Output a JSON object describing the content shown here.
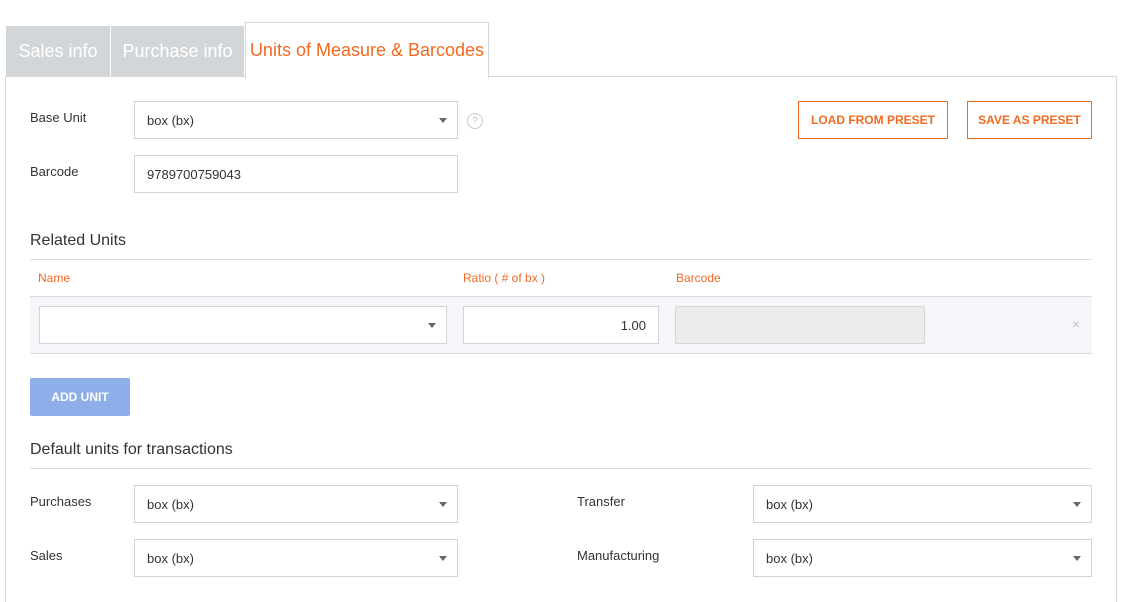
{
  "tabs": [
    {
      "label": "Sales info"
    },
    {
      "label": "Purchase info"
    },
    {
      "label": "Units of Measure & Barcodes"
    }
  ],
  "base_unit": {
    "label": "Base Unit",
    "value": "box (bx)",
    "help": "?"
  },
  "barcode": {
    "label": "Barcode",
    "value": "9789700759043"
  },
  "buttons": {
    "load_preset": "LOAD FROM PRESET",
    "save_preset": "SAVE AS PRESET",
    "add_unit": "ADD UNIT"
  },
  "related_units": {
    "title": "Related Units",
    "columns": [
      "Name",
      "Ratio ( # of bx )",
      "Barcode"
    ],
    "rows": [
      {
        "name": "",
        "ratio": "1.00",
        "barcode": ""
      }
    ],
    "remove_glyph": "×"
  },
  "defaults": {
    "title": "Default units for transactions",
    "purchases": {
      "label": "Purchases",
      "value": "box (bx)"
    },
    "sales": {
      "label": "Sales",
      "value": "box (bx)"
    },
    "transfer": {
      "label": "Transfer",
      "value": "box (bx)"
    },
    "manufacturing": {
      "label": "Manufacturing",
      "value": "box (bx)"
    }
  },
  "colors": {
    "accent": "#f16a21",
    "add_button": "#8daee9",
    "tab_inactive": "#d3d6d9"
  }
}
